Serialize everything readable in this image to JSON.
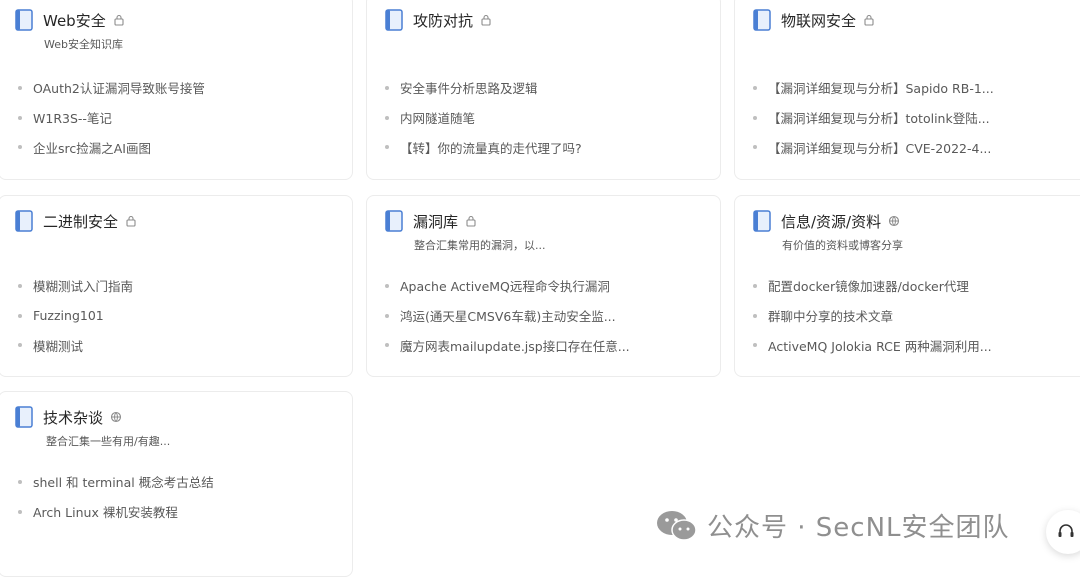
{
  "books": [
    {
      "title": "Web安全",
      "badge": "lock",
      "desc": "Web安全知识库",
      "docs": [
        "OAuth2认证漏洞导致账号接管",
        "W1R3S--笔记",
        "企业src捡漏之AI画图"
      ]
    },
    {
      "title": "攻防对抗",
      "badge": "lock",
      "desc": "",
      "docs": [
        "安全事件分析思路及逻辑",
        "内网隧道随笔",
        "【转】你的流量真的走代理了吗?"
      ]
    },
    {
      "title": "物联网安全",
      "badge": "lock",
      "desc": "",
      "docs": [
        "【漏洞详细复现与分析】Sapido RB-1...",
        "【漏洞详细复现与分析】totolink登陆...",
        "【漏洞详细复现与分析】CVE-2022-4..."
      ]
    },
    {
      "title": "二进制安全",
      "badge": "lock",
      "desc": "",
      "docs": [
        "模糊测试入门指南",
        "Fuzzing101",
        "模糊测试"
      ]
    },
    {
      "title": "漏洞库",
      "badge": "lock",
      "desc": "整合汇集常用的漏洞，以...",
      "docs": [
        "Apache ActiveMQ远程命令执行漏洞",
        "鸿运(通天星CMSV6车载)主动安全监...",
        "魔方网表mailupdate.jsp接口存在任意..."
      ]
    },
    {
      "title": "信息/资源/资料",
      "badge": "globe",
      "desc": "有价值的资料或博客分享",
      "docs": [
        "配置docker镜像加速器/docker代理",
        "群聊中分享的技术文章",
        "ActiveMQ Jolokia RCE 两种漏洞利用..."
      ]
    },
    {
      "title": "技术杂谈",
      "badge": "globe",
      "desc": "整合汇集一些有用/有趣...",
      "docs": [
        "shell 和 terminal 概念考古总结",
        "Arch Linux 裸机安装教程"
      ]
    }
  ],
  "watermark": "公众号 · SecNL安全团队",
  "colors": {
    "book_icon": "#4a7fd4",
    "book_icon_light": "#e8f0fc",
    "text": "#262626",
    "muted": "#595959"
  }
}
